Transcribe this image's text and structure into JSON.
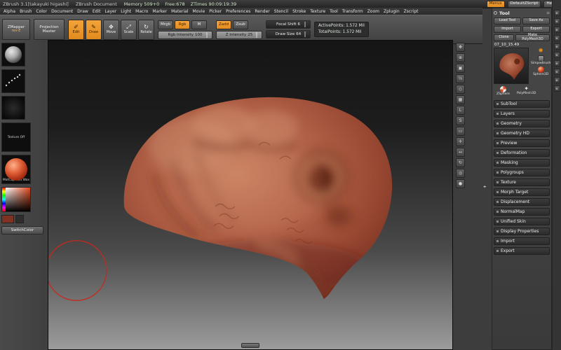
{
  "colors": {
    "accent_orange": "#e08a1e",
    "current_color": "#7e3322",
    "canvas_top": "#151515",
    "canvas_bottom": "#9c9c9c",
    "cursor_ring_red": "#c8281c"
  },
  "title_bar": {
    "app_title": "ZBrush 3.1[takayuki higashi]",
    "doc_title": "ZBrush Document",
    "memory": "Memory 509+0",
    "free": "Free:678",
    "ztimes": "ZTimes 90:09:19:39",
    "menus_button": "Menus",
    "zscript_button": "DefaultZScript",
    "help_button": "Help"
  },
  "menu_bar": {
    "items": [
      "Alpha",
      "Brush",
      "Color",
      "Document",
      "Draw",
      "Edit",
      "Layer",
      "Light",
      "Macro",
      "Marker",
      "Material",
      "Movie",
      "Picker",
      "Preferences",
      "Render",
      "Stencil",
      "Stroke",
      "Texture",
      "Tool",
      "Transform",
      "Zoom",
      "Zplugin",
      "Zscript"
    ]
  },
  "shelf": {
    "zmapper_label": "ZMapper",
    "zmapper_version": "rev-E",
    "projection_master": "Projection Master",
    "mode_buttons": [
      {
        "name": "edit-mode-button",
        "label": "Edit",
        "glyph": "✐",
        "active": true
      },
      {
        "name": "draw-mode-button",
        "label": "Draw",
        "glyph": "✎",
        "active": true
      },
      {
        "name": "move-mode-button",
        "label": "Move",
        "glyph": "✥"
      },
      {
        "name": "scale-mode-button",
        "label": "Scale",
        "glyph": "⤢"
      },
      {
        "name": "rotate-mode-button",
        "label": "Rotate",
        "glyph": "↻"
      }
    ],
    "paint_buttons": [
      {
        "name": "mrgb-button",
        "label": "Mrgb"
      },
      {
        "name": "rgb-button",
        "label": "Rgb",
        "active": true
      },
      {
        "name": "m-button",
        "label": "M"
      }
    ],
    "rgb_intensity": {
      "label": "Rgb Intensity",
      "value": "100"
    },
    "sculpt_buttons": [
      {
        "name": "zadd-button",
        "label": "Zadd",
        "active": true
      },
      {
        "name": "zsub-button",
        "label": "Zsub"
      }
    ],
    "z_intensity": {
      "label": "Z Intensity",
      "value": "25"
    },
    "focal_shift": {
      "label": "Focal Shift",
      "value": "6"
    },
    "draw_size": {
      "label": "Draw Size",
      "value": "64"
    },
    "active_points": "ActivePoints: 1.572 Mil",
    "total_points": "TotalPoints: 1.572 Mil"
  },
  "left_rail": {
    "texture_label": "Texture Off",
    "material_label": "MatCap Red Wax",
    "switch_color": "SwitchColor"
  },
  "right_rail": {
    "icons": [
      {
        "name": "scroll-icon",
        "glyph": "✥"
      },
      {
        "name": "zoom-icon",
        "glyph": "⊕"
      },
      {
        "name": "actual-size-icon",
        "glyph": "▣"
      },
      {
        "name": "aa-half-icon",
        "glyph": "½"
      },
      {
        "name": "persp-icon",
        "glyph": "◇"
      },
      {
        "name": "floor-grid-icon",
        "glyph": "▦"
      },
      {
        "name": "local-transform-icon",
        "glyph": "L"
      },
      {
        "name": "lsym-icon",
        "glyph": "S"
      },
      {
        "name": "frame-icon",
        "glyph": "▭"
      },
      {
        "name": "move-gyro-icon",
        "glyph": "✛"
      },
      {
        "name": "scale-gyro-icon",
        "glyph": "↔"
      },
      {
        "name": "rotate-gyro-icon",
        "glyph": "↻"
      },
      {
        "name": "xyz-icon",
        "glyph": "◎"
      },
      {
        "name": "marker-icon",
        "glyph": "●"
      }
    ]
  },
  "tray_rail": {
    "icons": [
      {
        "name": "tray-icon-1",
        "glyph": "▪"
      },
      {
        "name": "tray-icon-2",
        "glyph": "▪"
      },
      {
        "name": "tray-icon-3",
        "glyph": "▪"
      },
      {
        "name": "tray-icon-4",
        "glyph": "▪"
      },
      {
        "name": "tray-icon-5",
        "glyph": "▪"
      },
      {
        "name": "tray-icon-6",
        "glyph": "▪"
      },
      {
        "name": "tray-icon-7",
        "glyph": "▪"
      },
      {
        "name": "tray-icon-8",
        "glyph": "▪"
      },
      {
        "name": "tray-icon-9",
        "glyph": "▪"
      },
      {
        "name": "tray-icon-10",
        "glyph": "▪"
      }
    ]
  },
  "divider_glyph": "◂▸",
  "tool_palette": {
    "title": "Tool",
    "buttons_row1": [
      "Load Tool",
      "Save As"
    ],
    "buttons_row2": [
      "Import",
      "Export"
    ],
    "buttons_row3": [
      {
        "label": "Clone"
      },
      {
        "label": "Make PolyMesh3D",
        "wide": true
      }
    ],
    "tool_name": "07_10_15.49",
    "quick_items": [
      {
        "label": "SimpleBrush"
      },
      {
        "label": "Sphere3D"
      },
      {
        "label": "ZSphere"
      },
      {
        "label": "PolyMesh3D"
      }
    ],
    "sections": [
      "SubTool",
      "Layers",
      "Geometry",
      "Geometry HD",
      "Preview",
      "Deformation",
      "Masking",
      "Polygroups",
      "Texture",
      "Morph Target",
      "Displacement",
      "NormalMap",
      "Unified Skin",
      "Display Properties",
      "Import",
      "Export"
    ]
  }
}
